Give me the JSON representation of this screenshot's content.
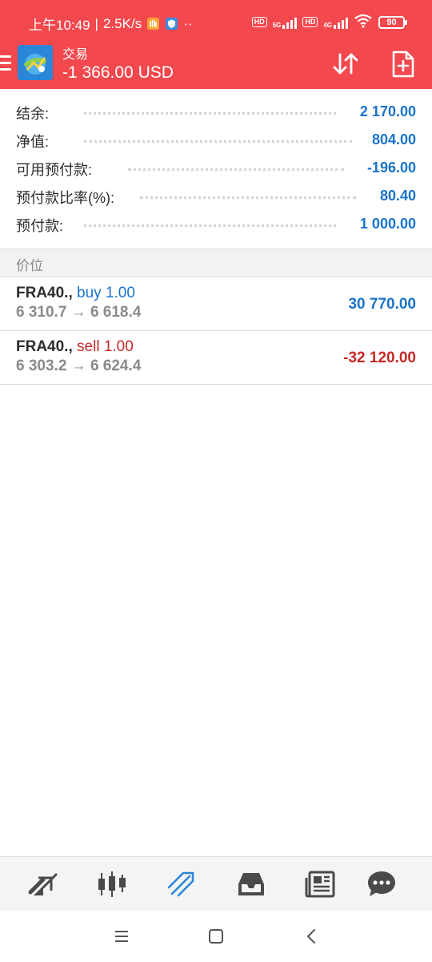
{
  "status_bar": {
    "time": "上午10:49",
    "speed": "2.5K/s",
    "dots": "··",
    "hd1": "HD",
    "net1": "5G",
    "hd2": "HD",
    "net2": "4G",
    "battery": "90"
  },
  "header": {
    "title": "交易",
    "balance": "-1 366.00 USD",
    "icons": [
      "menu-icon",
      "app-logo",
      "sort-icon",
      "new-order-icon"
    ]
  },
  "summary": [
    {
      "label": "结余:",
      "value": "2 170.00"
    },
    {
      "label": "净值:",
      "value": "804.00"
    },
    {
      "label": "可用预付款:",
      "value": "-196.00"
    },
    {
      "label": "预付款比率(%):",
      "value": "80.40"
    },
    {
      "label": "预付款:",
      "value": "1 000.00"
    }
  ],
  "section_title": "价位",
  "positions": [
    {
      "symbol": "FRA40.,",
      "direction": "buy",
      "volume": "1.00",
      "prices": "6 310.7 → 6 618.4",
      "profit": "30 770.00"
    },
    {
      "symbol": "FRA40.,",
      "direction": "sell",
      "volume": "1.00",
      "prices": "6 303.2 → 6 624.4",
      "profit": "-32 120.00"
    }
  ],
  "tabs": [
    "quotes-icon",
    "chart-icon",
    "trade-icon",
    "history-icon",
    "news-icon",
    "chat-icon"
  ],
  "system_nav": [
    "recent-apps-icon",
    "home-icon",
    "back-icon"
  ],
  "colors": {
    "header_red": "#f3484d",
    "value_blue": "#1a73c9",
    "loss_red": "#c62828",
    "active_tab": "#2a86d6"
  }
}
